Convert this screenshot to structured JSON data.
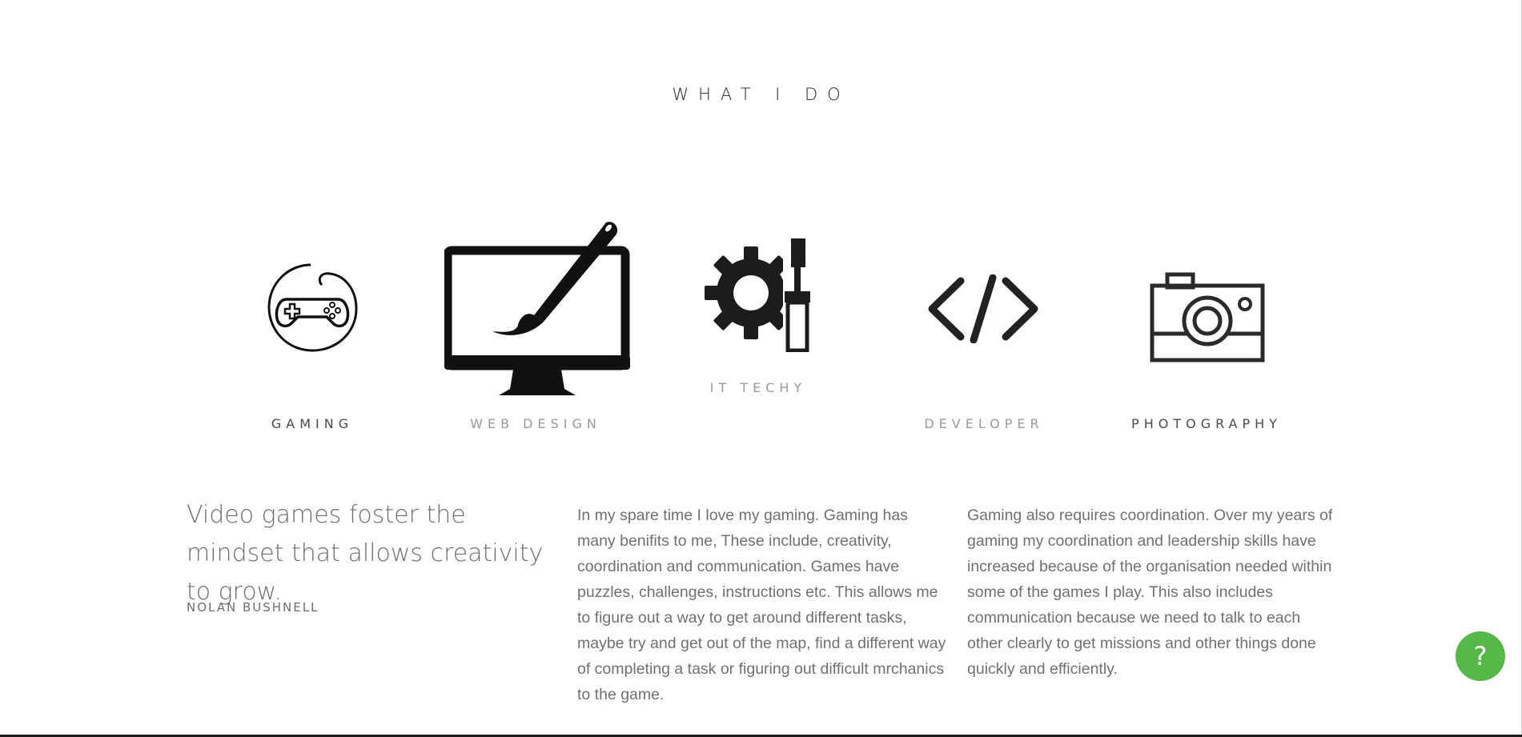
{
  "section": {
    "title": "WHAT I DO"
  },
  "services": [
    {
      "label": "GAMING",
      "icon": "gamepad-icon"
    },
    {
      "label": "WEB DESIGN",
      "icon": "monitor-brush-icon"
    },
    {
      "label": "IT TECHY",
      "icon": "gear-screwdriver-icon"
    },
    {
      "label": "DEVELOPER",
      "icon": "code-icon"
    },
    {
      "label": "PHOTOGRAPHY",
      "icon": "camera-icon"
    }
  ],
  "quote": {
    "text": "Video games foster the mindset that allows creativity to grow.",
    "author": "NOLAN BUSHNELL"
  },
  "paragraphs": [
    "In my spare time I love my gaming. Gaming has many benifits to me, These include, creativity, coordination and communication. Games have puzzles, challenges, instructions etc. This allows me to figure out a way to get around different tasks, maybe try and get out of the map, find a different way of completing a task or figuring out difficult mrchanics to the game.",
    "Gaming also requires coordination. Over my years of gaming my coordination and leadership skills have increased because of the organisation needed within some of the games I play. This also includes communication because we need to talk to each other clearly to get missions and other things done quickly and efficiently."
  ],
  "help": {
    "label": "?"
  },
  "colors": {
    "help_button": "#55b848",
    "icon_dark": "#1c1c1c"
  }
}
